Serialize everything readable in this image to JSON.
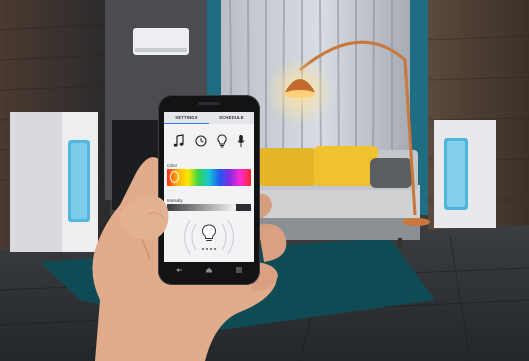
{
  "app": {
    "tabs": [
      "SETTINGS",
      "SCHEDULE"
    ],
    "active_tab": 0,
    "icons": [
      "music-note-icon",
      "clock-icon",
      "lightbulb-icon",
      "microphone-icon"
    ],
    "color_section_label": "Color",
    "intensity_section_label": "Intensity",
    "intensity_level": 0.82,
    "spectrum_colors": [
      "#ff2a1a",
      "#ffb400",
      "#ffe600",
      "#35d64a",
      "#19c6d6",
      "#1f5cf0",
      "#8a2be2",
      "#ff2ad2",
      "#ff2a2a"
    ],
    "nav_icons": [
      "back-icon",
      "home-icon",
      "menu-icon"
    ]
  },
  "colors": {
    "accent": "#3c7cf0",
    "sofa": "#e6b62a",
    "rug": "#0f4b55",
    "lamp_glow": "#ffd27a"
  }
}
